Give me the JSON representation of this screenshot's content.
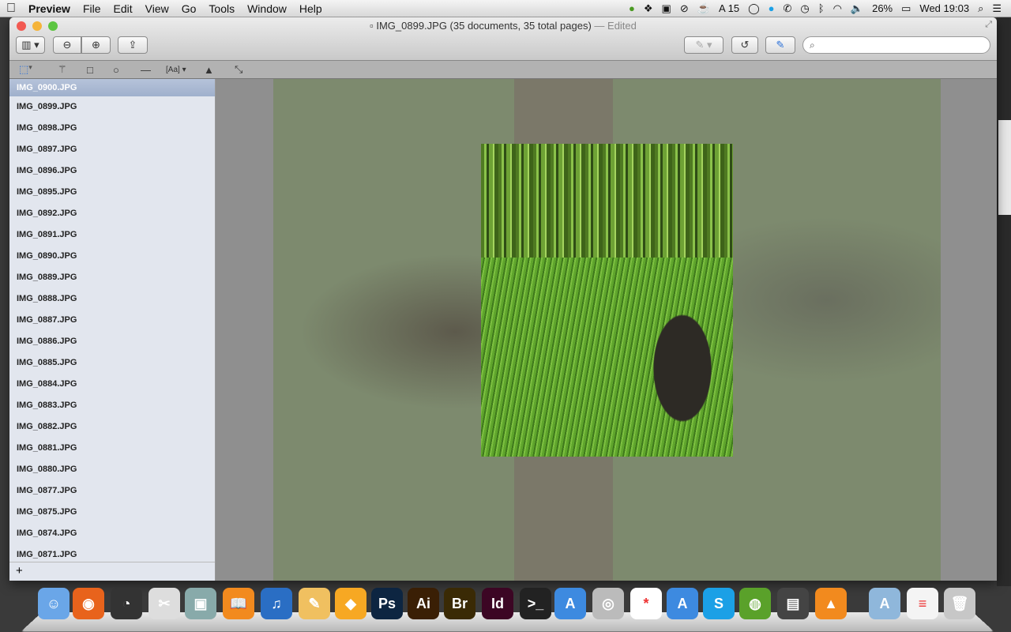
{
  "menubar": {
    "app": "Preview",
    "items": [
      "File",
      "Edit",
      "View",
      "Go",
      "Tools",
      "Window",
      "Help"
    ],
    "status": {
      "notif_count": "15",
      "battery": "26%",
      "clock": "Wed 19:03"
    }
  },
  "window": {
    "title": "IMG_0899.JPG (35 documents, 35 total pages)",
    "edited": "— Edited",
    "search_placeholder": ""
  },
  "sidebar": {
    "items": [
      "IMG_0900.JPG",
      "IMG_0899.JPG",
      "IMG_0898.JPG",
      "IMG_0897.JPG",
      "IMG_0896.JPG",
      "IMG_0895.JPG",
      "IMG_0892.JPG",
      "IMG_0891.JPG",
      "IMG_0890.JPG",
      "IMG_0889.JPG",
      "IMG_0888.JPG",
      "IMG_0887.JPG",
      "IMG_0886.JPG",
      "IMG_0885.JPG",
      "IMG_0884.JPG",
      "IMG_0883.JPG",
      "IMG_0882.JPG",
      "IMG_0881.JPG",
      "IMG_0880.JPG",
      "IMG_0877.JPG",
      "IMG_0875.JPG",
      "IMG_0874.JPG",
      "IMG_0871.JPG"
    ],
    "selected": "IMG_0900.JPG",
    "add": "+"
  },
  "dock": [
    {
      "name": "finder",
      "label": "☺",
      "color": "#6aa6e8"
    },
    {
      "name": "firefox",
      "label": "◉",
      "color": "#e8631c"
    },
    {
      "name": "dashboard",
      "label": "◔",
      "color": "#333"
    },
    {
      "name": "grab",
      "label": "✂",
      "color": "#ddd"
    },
    {
      "name": "iphoto",
      "label": "▣",
      "color": "#8aa"
    },
    {
      "name": "ibooks",
      "label": "📖",
      "color": "#f28a1e"
    },
    {
      "name": "itunes",
      "label": "♫",
      "color": "#2a6ec4"
    },
    {
      "name": "pages",
      "label": "✎",
      "color": "#f0c060"
    },
    {
      "name": "sketch",
      "label": "◆",
      "color": "#f7a823"
    },
    {
      "name": "photoshop",
      "label": "Ps",
      "color": "#0d2541"
    },
    {
      "name": "illustrator",
      "label": "Ai",
      "color": "#3a1f05"
    },
    {
      "name": "bridge",
      "label": "Br",
      "color": "#3a2a05"
    },
    {
      "name": "indesign",
      "label": "Id",
      "color": "#3c0624"
    },
    {
      "name": "terminal",
      "label": ">_",
      "color": "#222"
    },
    {
      "name": "xcode",
      "label": "A",
      "color": "#3d8ae0"
    },
    {
      "name": "facetime",
      "label": "◎",
      "color": "#bbb"
    },
    {
      "name": "filezilla",
      "label": "*",
      "color": "#fff"
    },
    {
      "name": "simulator",
      "label": "A",
      "color": "#3d8ae0"
    },
    {
      "name": "skype",
      "label": "S",
      "color": "#1ba0e6"
    },
    {
      "name": "tor",
      "label": "◍",
      "color": "#5aa12a"
    },
    {
      "name": "printer",
      "label": "▤",
      "color": "#444"
    },
    {
      "name": "vlc",
      "label": "▲",
      "color": "#f28a1e"
    },
    {
      "name": "applications",
      "label": "A",
      "color": "#8fb7db"
    },
    {
      "name": "document",
      "label": "≡",
      "color": "#f4f4f4"
    },
    {
      "name": "trash",
      "label": "🗑",
      "color": "#c7c7c7"
    }
  ]
}
